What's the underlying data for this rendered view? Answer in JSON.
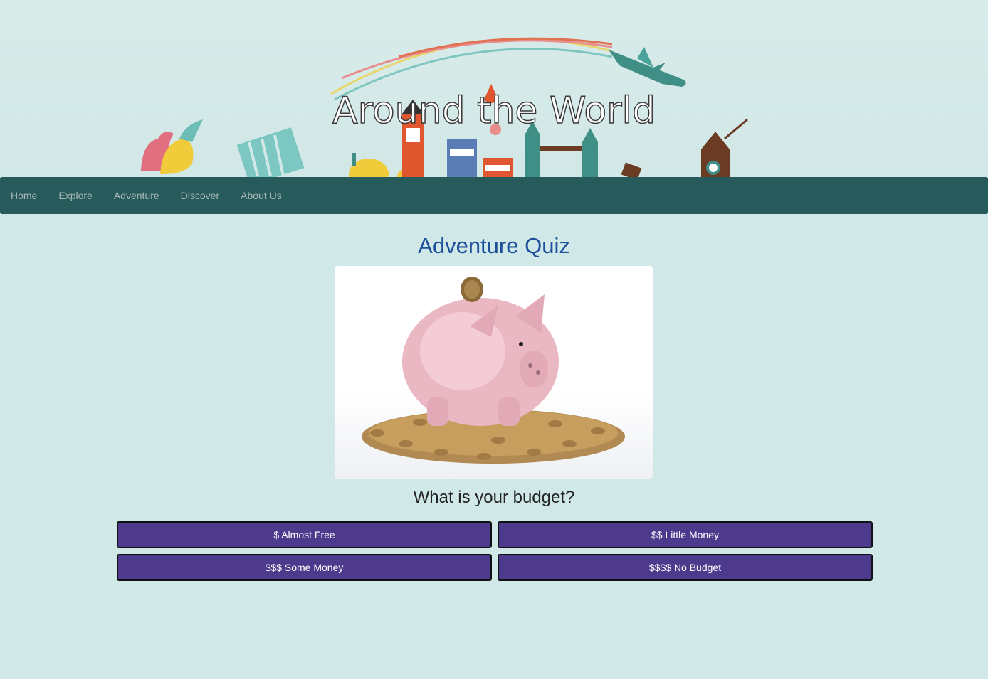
{
  "header": {
    "site_title": "Around the World"
  },
  "nav": {
    "items": [
      "Home",
      "Explore",
      "Adventure",
      "Discover",
      "About Us"
    ]
  },
  "main": {
    "title": "Adventure Quiz",
    "question": "What is your budget?",
    "answers": [
      "$ Almost Free",
      "$$ Little Money",
      "$$$ Some Money",
      "$$$$ No Budget"
    ]
  },
  "colors": {
    "page_bg": "#d0e9e8",
    "navbar": "#275a5a",
    "title": "#1d4f9a",
    "button": "#4e3a8d"
  }
}
